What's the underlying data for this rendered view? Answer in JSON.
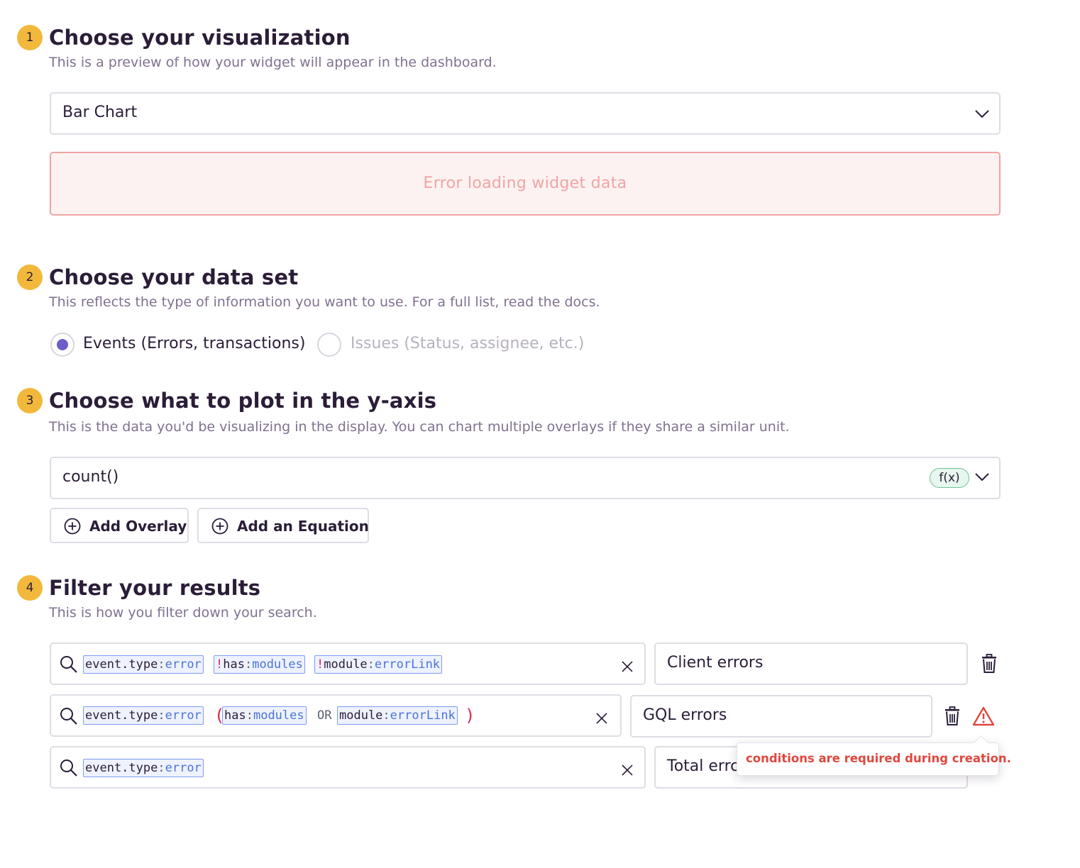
{
  "steps": [
    {
      "number": "1",
      "title": "Choose your visualization",
      "subtitle": "This is a preview of how your widget will appear in the dashboard."
    },
    {
      "number": "2",
      "title": "Choose your data set",
      "subtitle": "This reflects the type of information you want to use. For a full list, read the docs."
    },
    {
      "number": "3",
      "title": "Choose what to plot in the y-axis",
      "subtitle": "This is the data you'd be visualizing in the display. You can chart multiple overlays if they share a similar unit."
    },
    {
      "number": "4",
      "title": "Filter your results",
      "subtitle": "This is how you filter down your search."
    }
  ],
  "visualization": {
    "selected": "Bar Chart",
    "error_message": "Error loading widget data"
  },
  "dataset": {
    "options": [
      {
        "label": "Events (Errors, transactions)",
        "selected": true,
        "disabled": false
      },
      {
        "label": "Issues (Status, assignee, etc.)",
        "selected": false,
        "disabled": true
      }
    ]
  },
  "yaxis": {
    "field": "count()",
    "badge": "f(x)",
    "add_overlay_label": "Add Overlay",
    "add_equation_label": "Add an Equation"
  },
  "filters": [
    {
      "tokens": [
        {
          "key": "event.type",
          "sep": ":",
          "value": "error",
          "negated": false
        },
        {
          "key": "has",
          "sep": ":",
          "value": "modules",
          "negated": true
        },
        {
          "key": "module",
          "sep": ":",
          "value": "errorLink",
          "negated": true
        }
      ],
      "alias": "Client errors"
    },
    {
      "tokens": [
        {
          "key": "event.type",
          "sep": ":",
          "value": "error"
        },
        {
          "open_paren": "("
        },
        {
          "key": "has",
          "sep": ":",
          "value": "modules"
        },
        {
          "operator": "OR"
        },
        {
          "key": "module",
          "sep": ":",
          "value": "errorLink"
        },
        {
          "close_paren": ")"
        }
      ],
      "alias": "GQL errors"
    },
    {
      "tokens": [
        {
          "key": "event.type",
          "sep": ":",
          "value": "error"
        }
      ],
      "alias": "Total errc"
    }
  ],
  "tooltip": {
    "text": "conditions are required during creation."
  },
  "colors": {
    "accent": "#6c5fc7",
    "step_badge": "#f2b83b",
    "error_text": "#e0483e",
    "token_border": "#7f9cf1",
    "token_value": "#4a73d9",
    "negation": "#e0254e"
  },
  "icons": [
    "chevron-down-icon",
    "plus-circle-icon",
    "search-icon",
    "close-icon",
    "trash-icon",
    "warning-icon"
  ]
}
